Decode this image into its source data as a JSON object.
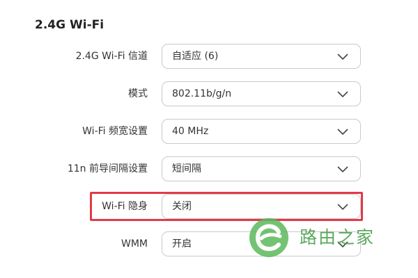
{
  "section": {
    "title": "2.4G Wi-Fi"
  },
  "settings": [
    {
      "label": "2.4G Wi-Fi 信道",
      "value": "自适应 (6)"
    },
    {
      "label": "模式",
      "value": "802.11b/g/n"
    },
    {
      "label": "Wi-Fi 频宽设置",
      "value": "40 MHz"
    },
    {
      "label": "11n 前导间隔设置",
      "value": "短间隔"
    },
    {
      "label": "Wi-Fi 隐身",
      "value": "关闭"
    },
    {
      "label": "WMM",
      "value": "开启"
    }
  ],
  "highlight": {
    "target": "Wi-Fi 隐身",
    "color": "#e23a48"
  },
  "watermark": {
    "text": "路由之家",
    "color": "#4aa04d",
    "icon": "leaf-e-logo-icon"
  }
}
